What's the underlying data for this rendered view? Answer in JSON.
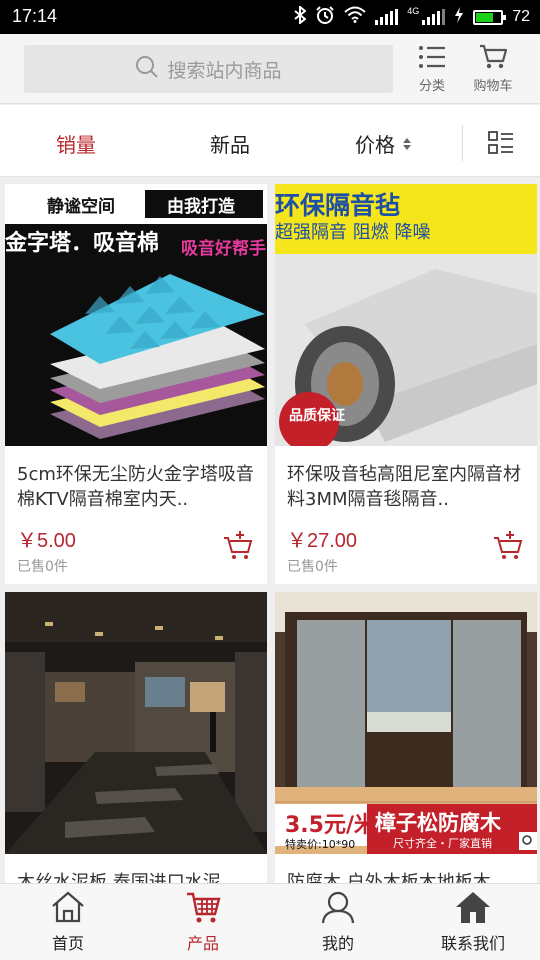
{
  "status_bar": {
    "time": "17:14",
    "network": "4G",
    "battery": "72"
  },
  "header": {
    "search_placeholder": "搜索站内商品",
    "category_label": "分类",
    "cart_label": "购物车"
  },
  "sort_bar": {
    "items": [
      {
        "label": "销量",
        "active": true
      },
      {
        "label": "新品",
        "active": false
      },
      {
        "label": "价格",
        "active": false
      }
    ]
  },
  "products": [
    {
      "title": "5cm环保无尘防火金字塔吸音棉KTV隔音棉室内天..",
      "price": "￥5.00",
      "sold": "已售0件",
      "image_text": {
        "tag1": "静谧空间",
        "tag2": "由我打造",
        "headline": "金字塔．吸音棉",
        "badge": "吸音好帮手"
      }
    },
    {
      "title": "环保吸音毡高阻尼室内隔音材料3MM隔音毯隔音..",
      "price": "￥27.00",
      "sold": "已售0件",
      "image_text": {
        "headline": "环保隔音毡",
        "sub": "超强隔音 阻燃 降噪",
        "badge": "品质保证"
      }
    },
    {
      "title": "木丝水泥板 泰国进口水泥",
      "price": "",
      "sold": "",
      "image_text": {}
    },
    {
      "title": "防腐木 户外木板木地板木",
      "price": "",
      "sold": "",
      "image_text": {
        "price_tag": "3.5元/米",
        "spec": "特卖价:10*90",
        "headline": "樟子松防腐木",
        "sub": "尺寸齐全・厂家直销"
      }
    }
  ],
  "tab_bar": {
    "items": [
      {
        "label": "首页",
        "icon": "home-icon",
        "active": false
      },
      {
        "label": "产品",
        "icon": "cart-icon",
        "active": true
      },
      {
        "label": "我的",
        "icon": "user-icon",
        "active": false
      },
      {
        "label": "联系我们",
        "icon": "house-icon",
        "active": false
      }
    ]
  },
  "colors": {
    "accent": "#b7272d",
    "header_bg": "#f5f5f5",
    "page_bg": "#efefef"
  }
}
